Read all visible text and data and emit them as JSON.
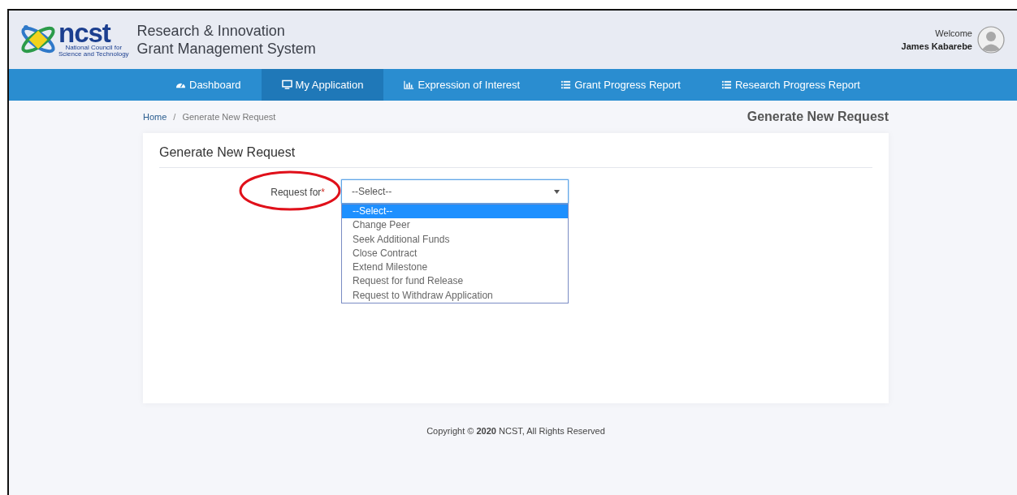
{
  "header": {
    "logo": {
      "mark": "ncst",
      "caption": [
        "National Council for",
        "Science and Technology"
      ]
    },
    "title_lines": [
      "Research & Innovation",
      "Grant Management System"
    ],
    "user": {
      "greeting": "Welcome",
      "name": "James Kabarebe"
    }
  },
  "nav": [
    {
      "label": "Dashboard",
      "kind": "gauge",
      "selected": false
    },
    {
      "label": "My Application",
      "kind": "monitor",
      "selected": true
    },
    {
      "label": "Expression of Interest",
      "kind": "chart",
      "selected": false
    },
    {
      "label": "Grant Progress Report",
      "kind": "list",
      "selected": false
    },
    {
      "label": "Research Progress Report",
      "kind": "list",
      "selected": false
    }
  ],
  "breadcrumb": [
    {
      "label": "Home",
      "kind": "link"
    },
    {
      "label": "/",
      "kind": "separator"
    },
    {
      "label": "Generate New Request",
      "kind": "current"
    }
  ],
  "page_title": "Generate New Request",
  "card": {
    "title": "Generate New Request",
    "field": {
      "label": "Request for",
      "required_mark": "*",
      "circled": true,
      "value": "--Select--",
      "expanded": true,
      "options": [
        {
          "label": "--Select--",
          "selected": true
        },
        {
          "label": "Change Peer",
          "selected": false
        },
        {
          "label": "Seek Additional Funds",
          "selected": false
        },
        {
          "label": "Close Contract",
          "selected": false
        },
        {
          "label": "Extend Milestone",
          "selected": false
        },
        {
          "label": "Request for fund Release",
          "selected": false
        },
        {
          "label": "Request to Withdraw Application",
          "selected": false
        }
      ]
    }
  },
  "footer": "Copyright © **2020** NCST, All Rights Reserved"
}
